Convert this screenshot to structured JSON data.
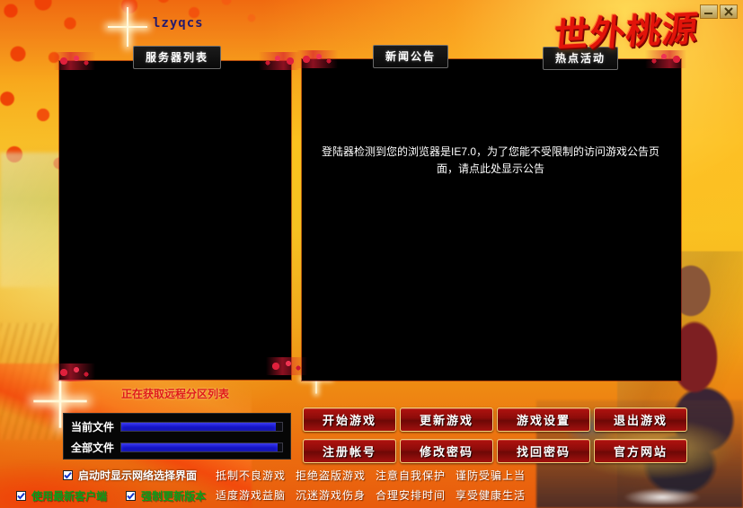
{
  "window": {
    "app_title": "lzyqcs",
    "logo_text": "世外桃源",
    "controls": [
      {
        "name": "minimize-button",
        "label": "—"
      },
      {
        "name": "close-button",
        "label": "✕"
      }
    ]
  },
  "panels": {
    "server_list_header": "服务器列表",
    "news_header": "新闻公告",
    "hot_activity_header": "热点活动",
    "news_message": "登陆器检测到您的浏览器是IE7.0，为了您能不受限制的访问游戏公告页面，请点此处显示公告"
  },
  "status": {
    "message": "正在获取远程分区列表"
  },
  "progress": {
    "current_file_label": "当前文件",
    "current_file_percent": 96,
    "all_files_label": "全部文件",
    "all_files_percent": 97
  },
  "options": [
    {
      "name": "show-network-select-on-start",
      "label": "启动时显示网络选择界面",
      "checked": true
    },
    {
      "name": "use-latest-client",
      "label": "使用最新客户端",
      "checked": true
    },
    {
      "name": "force-update-version",
      "label": "强制更新版本",
      "checked": true
    }
  ],
  "buttons": [
    {
      "name": "start-game-button",
      "label": "开始游戏"
    },
    {
      "name": "update-game-button",
      "label": "更新游戏"
    },
    {
      "name": "game-settings-button",
      "label": "游戏设置"
    },
    {
      "name": "exit-game-button",
      "label": "退出游戏"
    },
    {
      "name": "register-account-button",
      "label": "注册帐号"
    },
    {
      "name": "change-password-button",
      "label": "修改密码"
    },
    {
      "name": "retrieve-password-button",
      "label": "找回密码"
    },
    {
      "name": "official-website-button",
      "label": "官方网站"
    }
  ],
  "warning": {
    "line1": [
      "抵制不良游戏",
      "拒绝盗版游戏",
      "注意自我保护",
      "谨防受骗上当"
    ],
    "line2": [
      "适度游戏益脑",
      "沉迷游戏伤身",
      "合理安排时间",
      "享受健康生活"
    ]
  },
  "colors": {
    "bg_orange": "#f8a81c",
    "bg_yellow": "#fbc21f",
    "button_red": "#8e0c0a",
    "button_border_gold": "#f3d27a",
    "progress_blue": "#1414c8",
    "status_red": "#e01a1a",
    "green_label": "#0a9e1a",
    "logo_red": "#e2140a",
    "title_navy": "#241b6e"
  }
}
